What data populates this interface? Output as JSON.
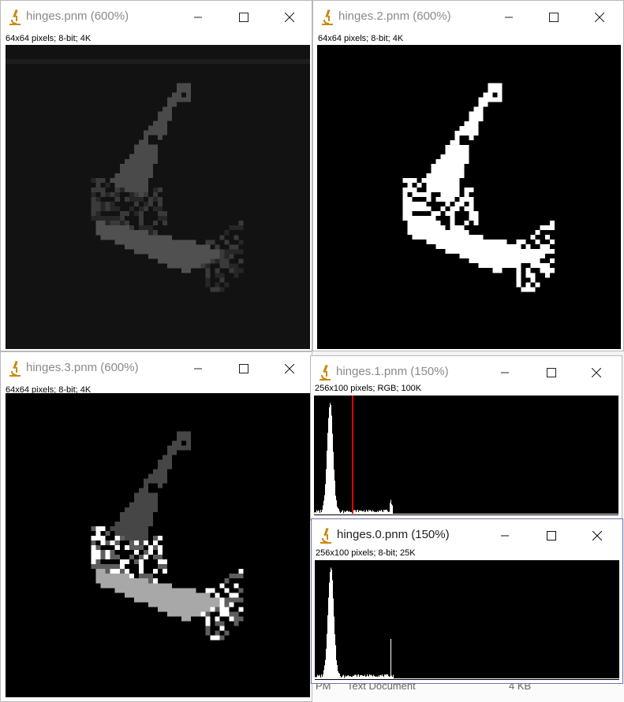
{
  "background": {
    "bottom_row": [
      "PM",
      "Text Document",
      "4 KB"
    ]
  },
  "windows": [
    {
      "id": "w-hinges",
      "title": "hinges.pnm (600%)",
      "info": "64x64 pixels; 8-bit; 4K",
      "active": false
    },
    {
      "id": "w-hinges2",
      "title": "hinges.2.pnm (600%)",
      "info": "64x64 pixels; 8-bit; 4K",
      "active": false
    },
    {
      "id": "w-hinges3",
      "title": "hinges.3.pnm (600%)",
      "info": "64x64 pixels; 8-bit; 4K",
      "active": false
    },
    {
      "id": "w-hinges1",
      "title": "hinges.1.pnm (150%)",
      "info": "256x100 pixels; RGB; 100K",
      "active": false
    },
    {
      "id": "w-hinges0",
      "title": "hinges.0.pnm (150%)",
      "info": "256x100 pixels; 8-bit; 25K",
      "active": true
    }
  ],
  "icons": {
    "app": "imagej-microscope-icon",
    "minimize": "minimize-icon",
    "maximize": "maximize-icon",
    "close": "close-icon"
  },
  "colors": {
    "active_border": "#6b74b8",
    "marker_line": "#e00000",
    "window_bg": "#ffffff",
    "image_bg": "#000000"
  }
}
